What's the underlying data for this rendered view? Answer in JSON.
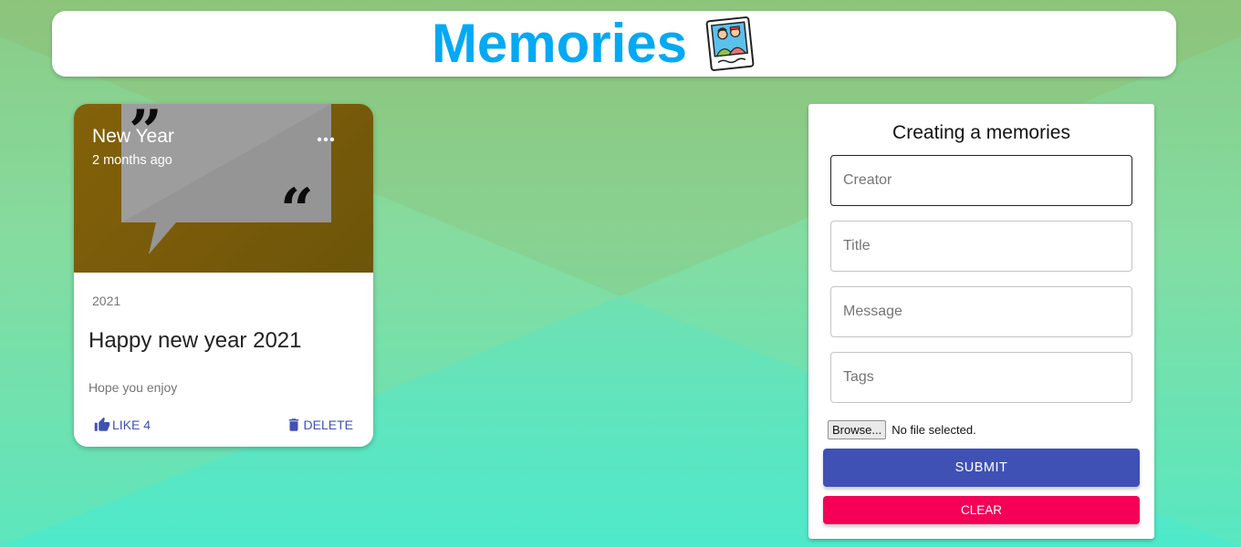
{
  "app": {
    "title": "Memories",
    "logo_icon": "photo-memories-icon",
    "accent_color": "#03a9f4"
  },
  "post": {
    "title": "New Year",
    "time_ago": "2 months ago",
    "tags": "2021",
    "heading": "Happy new year 2021",
    "message": "Hope you enjoy",
    "like_label": "LIKE 4",
    "delete_label": "DELETE",
    "more_icon": "more-horiz-icon",
    "like_icon": "thumb-up-icon",
    "delete_icon": "trash-icon"
  },
  "form": {
    "title": "Creating a memories",
    "creator_placeholder": "Creator",
    "title_placeholder": "Title",
    "message_placeholder": "Message",
    "tags_placeholder": "Tags",
    "browse_label": "Browse...",
    "file_status": "No file selected.",
    "submit_label": "SUBMIT",
    "clear_label": "CLEAR",
    "submit_color": "#3f51b5",
    "clear_color": "#f50057"
  }
}
